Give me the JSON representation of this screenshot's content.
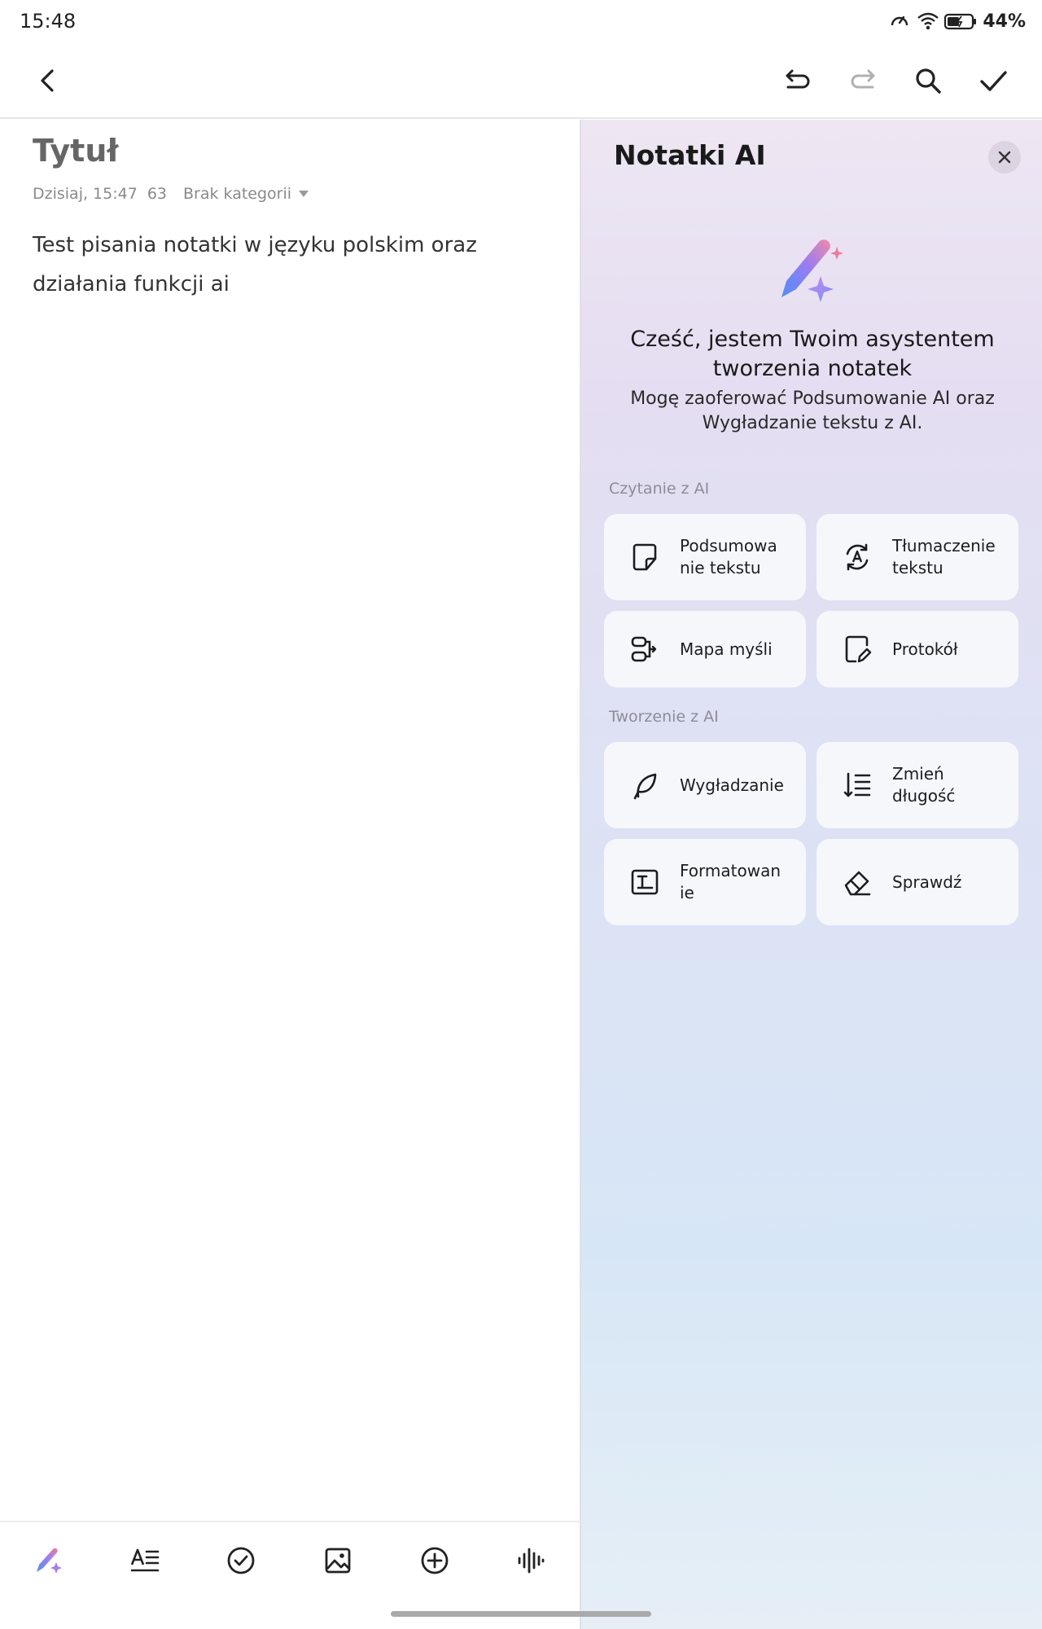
{
  "status_bar": {
    "time": "15:48",
    "battery": "44%"
  },
  "note": {
    "title": "Tytuł",
    "date": "Dzisiaj, 15:47",
    "char_count": "63",
    "category": "Brak kategorii",
    "body": "Test pisania notatki w języku polskim oraz działania funkcji ai"
  },
  "ai_panel": {
    "title": "Notatki AI",
    "greeting": "Cześć, jestem Twoim asystentem tworzenia notatek",
    "greeting_sub": "Mogę zaoferować Podsumowanie AI oraz Wygładzanie tekstu z AI.",
    "reading_section": {
      "label": "Czytanie z AI",
      "items": [
        {
          "label": "Podsumowa nie tekstu",
          "icon": "note-icon"
        },
        {
          "label": "Tłumaczenie tekstu",
          "icon": "translate-icon"
        },
        {
          "label": "Mapa myśli",
          "icon": "mind-map-icon"
        },
        {
          "label": "Protokół",
          "icon": "protocol-icon"
        }
      ]
    },
    "creating_section": {
      "label": "Tworzenie z AI",
      "items": [
        {
          "label": "Wygładzanie",
          "icon": "feather-icon"
        },
        {
          "label": "Zmień długość",
          "icon": "length-icon"
        },
        {
          "label": "Formatowan ie",
          "icon": "format-icon"
        },
        {
          "label": "Sprawdź",
          "icon": "eraser-icon"
        }
      ]
    }
  },
  "toolbar_icons": [
    "ai-pen-icon",
    "text-format-icon",
    "checklist-icon",
    "image-icon",
    "add-icon",
    "audio-icon"
  ],
  "colors": {
    "accent_purple": "#a67cf0",
    "accent_blue": "#5b8ff5",
    "accent_pink": "#f07aa0"
  }
}
